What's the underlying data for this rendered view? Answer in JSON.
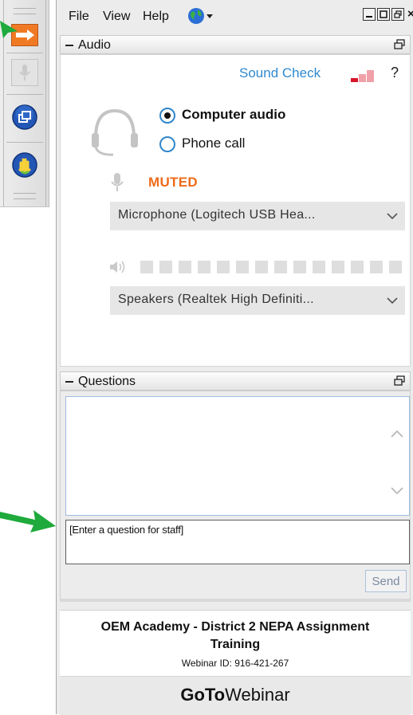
{
  "menu": {
    "file": "File",
    "view": "View",
    "help": "Help"
  },
  "audio": {
    "section_title": "Audio",
    "sound_check": "Sound Check",
    "help_label": "?",
    "option_computer": "Computer audio",
    "option_phone": "Phone call",
    "selected_option": "Computer audio",
    "mic_status": "MUTED",
    "microphone": "Microphone (Logitech USB Hea...",
    "speakers": "Speakers (Realtek High Definiti...",
    "speaker_level": 0
  },
  "questions": {
    "section_title": "Questions",
    "input_value": "[Enter a question for staff]",
    "send_label": "Send"
  },
  "footer": {
    "event_title_line1": "OEM Academy - District 2 NEPA Assignment",
    "event_title_line2": "Training",
    "webinar_id": "Webinar ID: 916-421-267",
    "brand_bold": "GoTo",
    "brand_regular": "Webinar"
  },
  "colors": {
    "accent_blue": "#2f89d0",
    "muted_orange": "#ee6b1a",
    "annotation_green": "#1eaa3c"
  }
}
